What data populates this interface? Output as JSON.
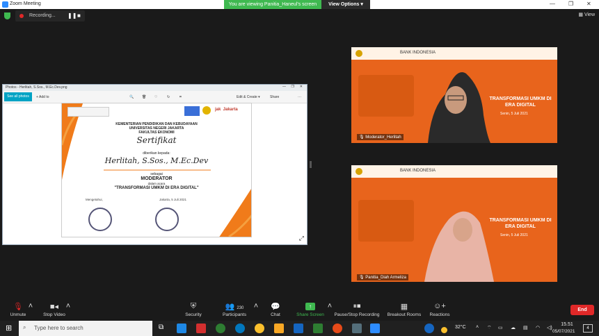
{
  "window": {
    "title": "Zoom Meeting"
  },
  "banner": {
    "text": "You are viewing Panitia_Haneul's screen",
    "view_options": "View Options"
  },
  "recording": {
    "label": "Recording..."
  },
  "view": {
    "label": "View"
  },
  "photos": {
    "title": "Photos - Herlitah, S.Sos., M.Ec.Dev.png",
    "see_all": "See all photos",
    "add_to": "Add to",
    "edit_create": "Edit & Create",
    "share": "Share"
  },
  "certificate": {
    "ministry": "KEMENTERIAN PENDIDIKAN DAN KEBUDAYAAN",
    "university": "UNIVERSITAS NEGERI JAKARTA",
    "faculty": "FAKULTAS EKONOMI",
    "heading": "Sertifikat",
    "given_to": "diberikan kepada:",
    "name": "Herlitah, S.Sos., M.Ec.Dev",
    "sebagai": "sebagai",
    "role": "MODERATOR",
    "dalam_acara": "dalam acara",
    "event": "\"TRANSFORMASI UMKM DI ERA DIGITAL\"",
    "left_sig": "Mengetahui,",
    "right_sig": "Jakarta, 5 Juli 2021"
  },
  "tiles": [
    {
      "name": "Moderator_Herlitah",
      "brand": "BANK INDONESIA",
      "headline": "TRANSFORMASI UMKM DI ERA DIGITAL",
      "date": "Senin, 5 Juli 2021"
    },
    {
      "name": "Panitia_Diah Armeliza",
      "brand": "BANK INDONESIA",
      "headline": "TRANSFORMASI UMKM DI ERA DIGITAL",
      "date": "Senin, 5 Juli 2021"
    }
  ],
  "toolbar": {
    "unmute": "Unmute",
    "stop_video": "Stop Video",
    "security": "Security",
    "participants": "Participants",
    "participants_count": "230",
    "chat": "Chat",
    "share_screen": "Share Screen",
    "pause_recording": "Pause/Stop Recording",
    "breakout_rooms": "Breakout Rooms",
    "reactions": "Reactions",
    "end": "End"
  },
  "taskbar": {
    "search_placeholder": "Type here to search",
    "temp": "32°C",
    "time": "15.51",
    "date": "05/07/2021",
    "notif_count": "4"
  },
  "colors": {
    "accent_green": "#3fb950",
    "tile_orange": "#e8641c",
    "end_red": "#e02828"
  }
}
